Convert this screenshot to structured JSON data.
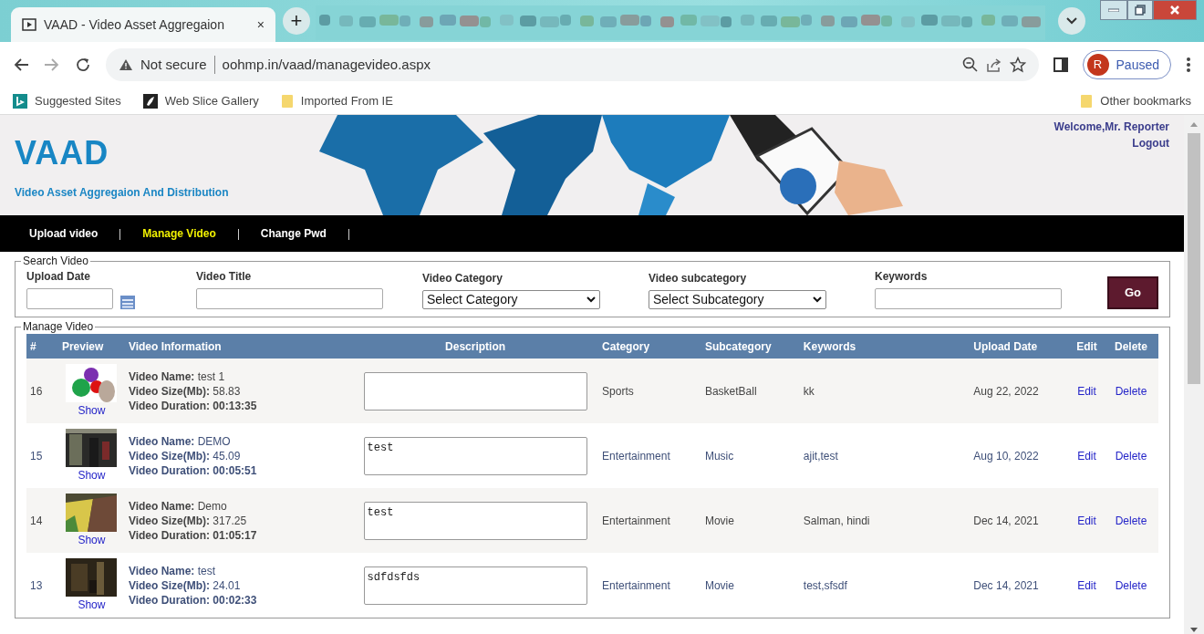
{
  "browser": {
    "tab_title": "VAAD - Video Asset Aggregaion",
    "tab_close": "×",
    "new_tab": "+",
    "url_warning": "Not secure",
    "url": "oohmp.in/vaad/managevideo.aspx",
    "profile_initial": "R",
    "profile_status": "Paused",
    "bookmarks": [
      {
        "label": "Suggested Sites",
        "kind": "bing"
      },
      {
        "label": "Web Slice Gallery",
        "kind": "slice"
      },
      {
        "label": "Imported From IE",
        "kind": "folder"
      }
    ],
    "other_bookmarks": "Other bookmarks"
  },
  "site": {
    "title": "VAAD",
    "subtitle": "Video Asset Aggregaion And Distribution",
    "welcome": "Welcome,Mr. Reporter",
    "logout": "Logout"
  },
  "nav": [
    {
      "label": "Upload video",
      "selected": false
    },
    {
      "label": "Manage Video",
      "selected": true
    },
    {
      "label": "Change Pwd",
      "selected": false
    }
  ],
  "search": {
    "legend": "Search Video",
    "upload_date": "Upload Date",
    "video_title": "Video Title",
    "video_category": "Video Category",
    "category_select": "Select Category",
    "video_subcategory": "Video subcategory",
    "subcategory_select": "Select Subcategory",
    "keywords": "Keywords",
    "go": "Go"
  },
  "manage": {
    "legend": "Manage Video",
    "columns": [
      "#",
      "Preview",
      "Video Information",
      "Description",
      "Category",
      "Subcategory",
      "Keywords",
      "Upload Date",
      "Edit",
      "Delete"
    ],
    "rows": [
      {
        "number": "16",
        "show": "Show",
        "info": [
          {
            "label": "Video Name:",
            "value": "test 1",
            "bold": false
          },
          {
            "label": "Video Size(Mb):",
            "value": "58.83",
            "bold": false
          },
          {
            "label": "Video Duration:",
            "value": "00:13:35",
            "bold": true
          }
        ],
        "category": "Sports",
        "subcategory": "BasketBall",
        "keywords": "kk",
        "upload_date": "Aug 22, 2022",
        "edit": "Edit",
        "delete": "Delete"
      },
      {
        "number": "15",
        "show": "Show",
        "info": [
          {
            "label": "Video Name:",
            "value": "DEMO",
            "bold": false
          },
          {
            "label": "Video Size(Mb):",
            "value": "45.09",
            "bold": false
          },
          {
            "label": "Video Duration:",
            "value": "00:05:51",
            "bold": true
          }
        ],
        "description": "test",
        "category": "Entertainment",
        "subcategory": "Music",
        "keywords": "ajit,test",
        "upload_date": "Aug 10, 2022",
        "edit": "Edit",
        "delete": "Delete"
      },
      {
        "number": "14",
        "show": "Show",
        "info": [
          {
            "label": "Video Name:",
            "value": "Demo",
            "bold": false
          },
          {
            "label": "Video Size(Mb):",
            "value": "317.25",
            "bold": false
          },
          {
            "label": "Video Duration:",
            "value": "01:05:17",
            "bold": true
          }
        ],
        "description": "test",
        "category": "Entertainment",
        "subcategory": "Movie",
        "keywords": "Salman, hindi",
        "upload_date": "Dec 14, 2021",
        "edit": "Edit",
        "delete": "Delete"
      },
      {
        "number": "13",
        "show": "Show",
        "info": [
          {
            "label": "Video Name:",
            "value": "test",
            "bold": false
          },
          {
            "label": "Video Size(Mb):",
            "value": "24.01",
            "bold": false
          },
          {
            "label": "Video Duration:",
            "value": "00:02:33",
            "bold": true
          }
        ],
        "description": "sdfdsfds",
        "category": "Entertainment",
        "subcategory": "Movie",
        "keywords": "test,sfsdf",
        "upload_date": "Dec 14, 2021",
        "edit": "Edit",
        "delete": "Delete"
      }
    ]
  }
}
